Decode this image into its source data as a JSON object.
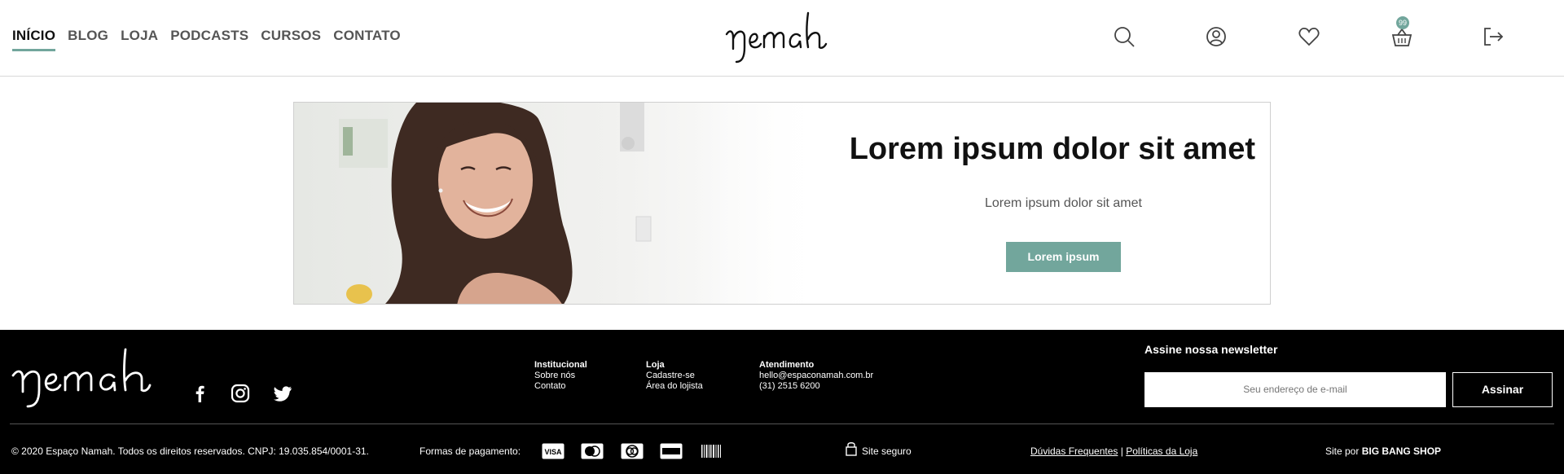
{
  "nav": {
    "items": [
      {
        "label": "INÍCIO",
        "active": true
      },
      {
        "label": "BLOG",
        "active": false
      },
      {
        "label": "LOJA",
        "active": false
      },
      {
        "label": "PODCASTS",
        "active": false
      },
      {
        "label": "CURSOS",
        "active": false
      },
      {
        "label": "CONTATO",
        "active": false
      }
    ]
  },
  "header": {
    "icons": [
      "search-icon",
      "user-icon",
      "heart-icon",
      "basket-icon",
      "logout-icon"
    ],
    "cart_count": "99"
  },
  "banner": {
    "title": "Lorem ipsum dolor sit amet",
    "subtitle": "Lorem ipsum dolor sit amet",
    "button_label": "Lorem ipsum"
  },
  "footer": {
    "columns": [
      {
        "heading": "Institucional",
        "items": [
          "Sobre nós",
          "Contato"
        ]
      },
      {
        "heading": "Loja",
        "items": [
          "Cadastre-se",
          "Área do lojista"
        ]
      },
      {
        "heading": "Atendimento",
        "items": [
          "hello@espaconamah.com.br",
          "(31) 2515 6200"
        ]
      }
    ],
    "newsletter": {
      "title": "Assine nossa newsletter",
      "placeholder": "Seu endereço de e-mail",
      "button_label": "Assinar"
    },
    "copyright": "© 2020 Espaço Namah. Todos os direitos reservados. CNPJ: 19.035.854/0001-31.",
    "payment_label": "Formas de pagamento:",
    "secure": "Site seguro",
    "faq": "Dúvidas Frequentes",
    "separator": "|",
    "policies": "Políticas da Loja",
    "credit_prefix": "Site por",
    "credit_name": "BIG BANG SHOP"
  },
  "colors": {
    "accent": "#72a69c",
    "footer_bg": "#000000"
  }
}
